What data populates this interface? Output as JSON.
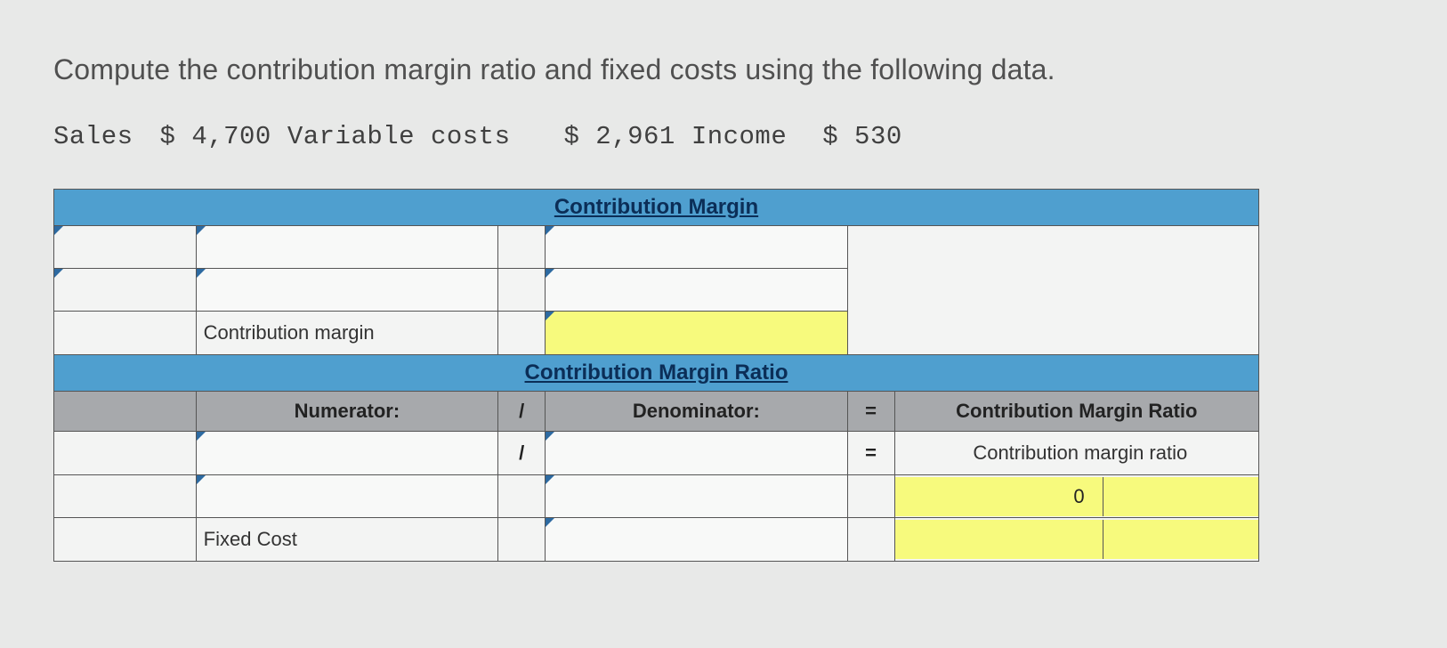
{
  "instruction": "Compute the contribution margin ratio and fixed costs using the following data.",
  "data_line": {
    "sales_label": "Sales",
    "sales_value": "$ 4,700",
    "varcost_label": "Variable costs",
    "varcost_value": "$ 2,961",
    "income_label": "Income",
    "income_value": "$ 530"
  },
  "sections": {
    "cm_header": "Contribution Margin",
    "cm_row_label": "Contribution margin",
    "cmr_header": "Contribution Margin Ratio",
    "numerator_label": "Numerator:",
    "denominator_label": "Denominator:",
    "result_header": "Contribution Margin Ratio",
    "result_row_label": "Contribution margin ratio",
    "fixed_cost_label": "Fixed Cost",
    "zero_value": "0",
    "divide_op": "/",
    "equals_op": "="
  }
}
